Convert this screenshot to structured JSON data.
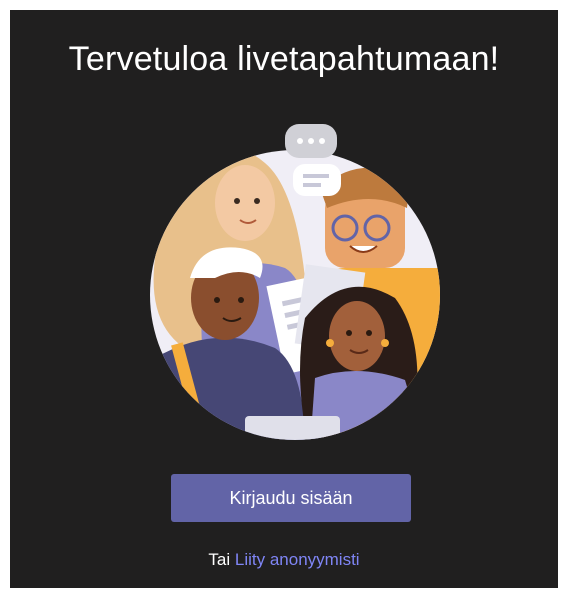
{
  "page": {
    "title": "Tervetuloa livetapahtumaan!",
    "signin_label": "Kirjaudu sisään",
    "or_text": "Tai",
    "anonymous_link": "Liity anonyymisti"
  },
  "colors": {
    "background": "#201f1f",
    "accent": "#6264a7",
    "link": "#7f85f5"
  },
  "icons": {
    "illustration": "people-group-illustration"
  }
}
